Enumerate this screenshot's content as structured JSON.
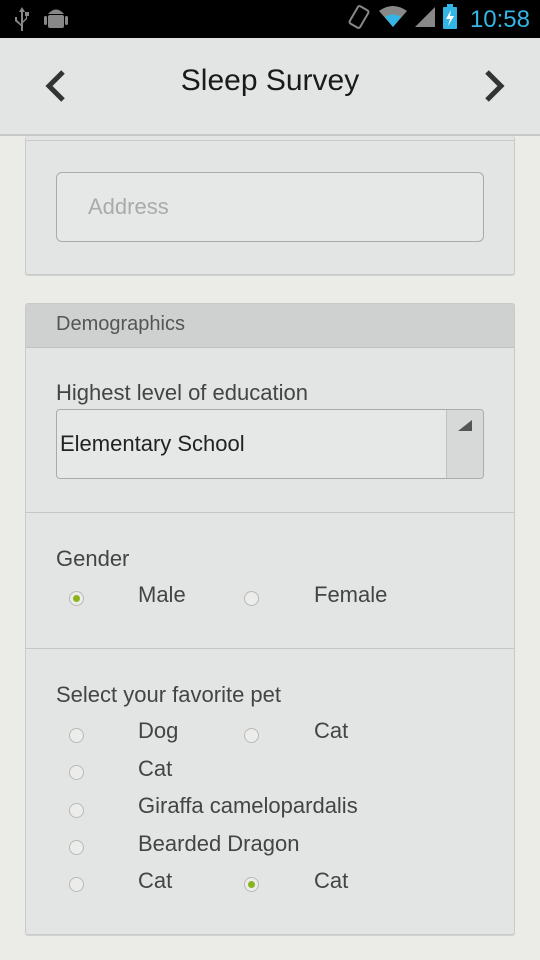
{
  "status_bar": {
    "time": "10:58",
    "icons": [
      "usb-icon",
      "android-debug-icon",
      "vibrate-icon",
      "wifi-icon",
      "signal-icon",
      "battery-charging-icon"
    ]
  },
  "action_bar": {
    "title": "Sleep Survey",
    "prev_icon": "chevron-left-icon",
    "next_icon": "chevron-right-icon"
  },
  "address": {
    "placeholder": "Address",
    "value": ""
  },
  "demographics": {
    "header": "Demographics",
    "education": {
      "label": "Highest level of education",
      "selected": "Elementary School"
    },
    "gender": {
      "label": "Gender",
      "options": [
        {
          "label": "Male",
          "checked": true
        },
        {
          "label": "Female",
          "checked": false
        }
      ]
    },
    "pet": {
      "label": "Select your favorite pet",
      "options": [
        {
          "label": "Dog",
          "checked": false
        },
        {
          "label": "Cat",
          "checked": false
        },
        {
          "label": "Cat",
          "checked": false
        },
        {
          "label": "Giraffa camelopardalis",
          "checked": false
        },
        {
          "label": "Bearded Dragon",
          "checked": false
        },
        {
          "label": "Cat",
          "checked": false
        },
        {
          "label": "Cat",
          "checked": true
        }
      ]
    }
  },
  "colors": {
    "accent": "#8ab41e",
    "clock": "#33b5e5"
  }
}
